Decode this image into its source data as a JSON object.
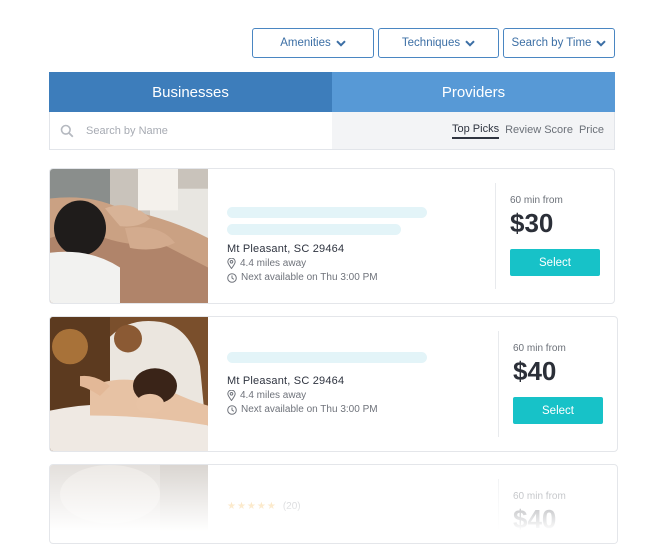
{
  "filters": {
    "amenities": "Amenities",
    "techniques": "Techniques",
    "search_by_time": "Search by Time"
  },
  "tabs": {
    "businesses": "Businesses",
    "providers": "Providers"
  },
  "search": {
    "placeholder": "Search by Name"
  },
  "sort": {
    "top_picks": "Top Picks",
    "review_score": "Review Score",
    "price": "Price"
  },
  "listings": [
    {
      "address": "Mt Pleasant, SC 29464",
      "distance": "4.4 miles away",
      "availability": "Next available on Thu 3:00 PM",
      "duration_from": "60 min from",
      "price": "$30",
      "select_label": "Select"
    },
    {
      "address": "Mt Pleasant, SC 29464",
      "distance": "4.4 miles away",
      "availability": "Next available on Thu 3:00 PM",
      "duration_from": "60 min from",
      "price": "$40",
      "select_label": "Select"
    },
    {
      "stars": "★★★★★",
      "review_count": "(20)",
      "duration_from": "60 min from",
      "price": "$40"
    }
  ],
  "colors": {
    "primary_tab": "#3d7dbb",
    "secondary_tab": "#5799d6",
    "accent": "#17c2c8"
  }
}
